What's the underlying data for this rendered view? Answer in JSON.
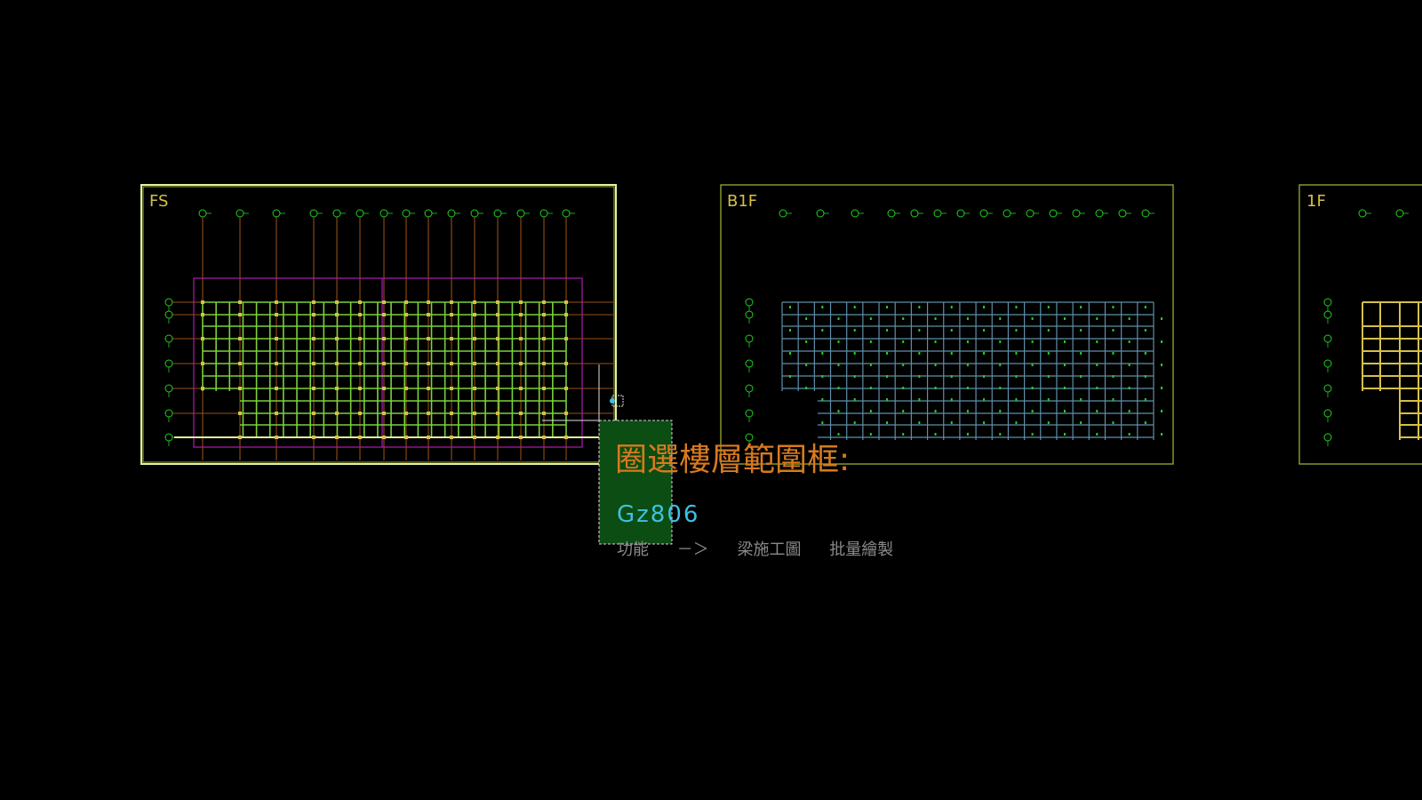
{
  "colors": {
    "background": "#000000",
    "sheet_frame": "#a9b83a",
    "selected_frame": "#e6f0a0",
    "axis_bubble": "#21d11f",
    "grid_line": "#c86a1e",
    "beam_fs": "#7ad13a",
    "beam_b1f": "#5d8fa8",
    "beam_1f": "#d6c04a",
    "zone": "#b01ab0",
    "prompt": "#d77a1f",
    "command": "#3fc0e0",
    "breadcrumb": "#8a8a8a",
    "selection_fill": "#0b4d12"
  },
  "sheets": [
    {
      "label": "FS",
      "selected": true
    },
    {
      "label": "B1F",
      "selected": false
    },
    {
      "label": "1F",
      "selected": false
    }
  ],
  "prompt": {
    "text": "圈選樓層範圍框:"
  },
  "command": {
    "text": "Gz806"
  },
  "breadcrumb": {
    "items": [
      "功能",
      "－＞",
      "梁施工圖",
      "批量繪製"
    ]
  }
}
